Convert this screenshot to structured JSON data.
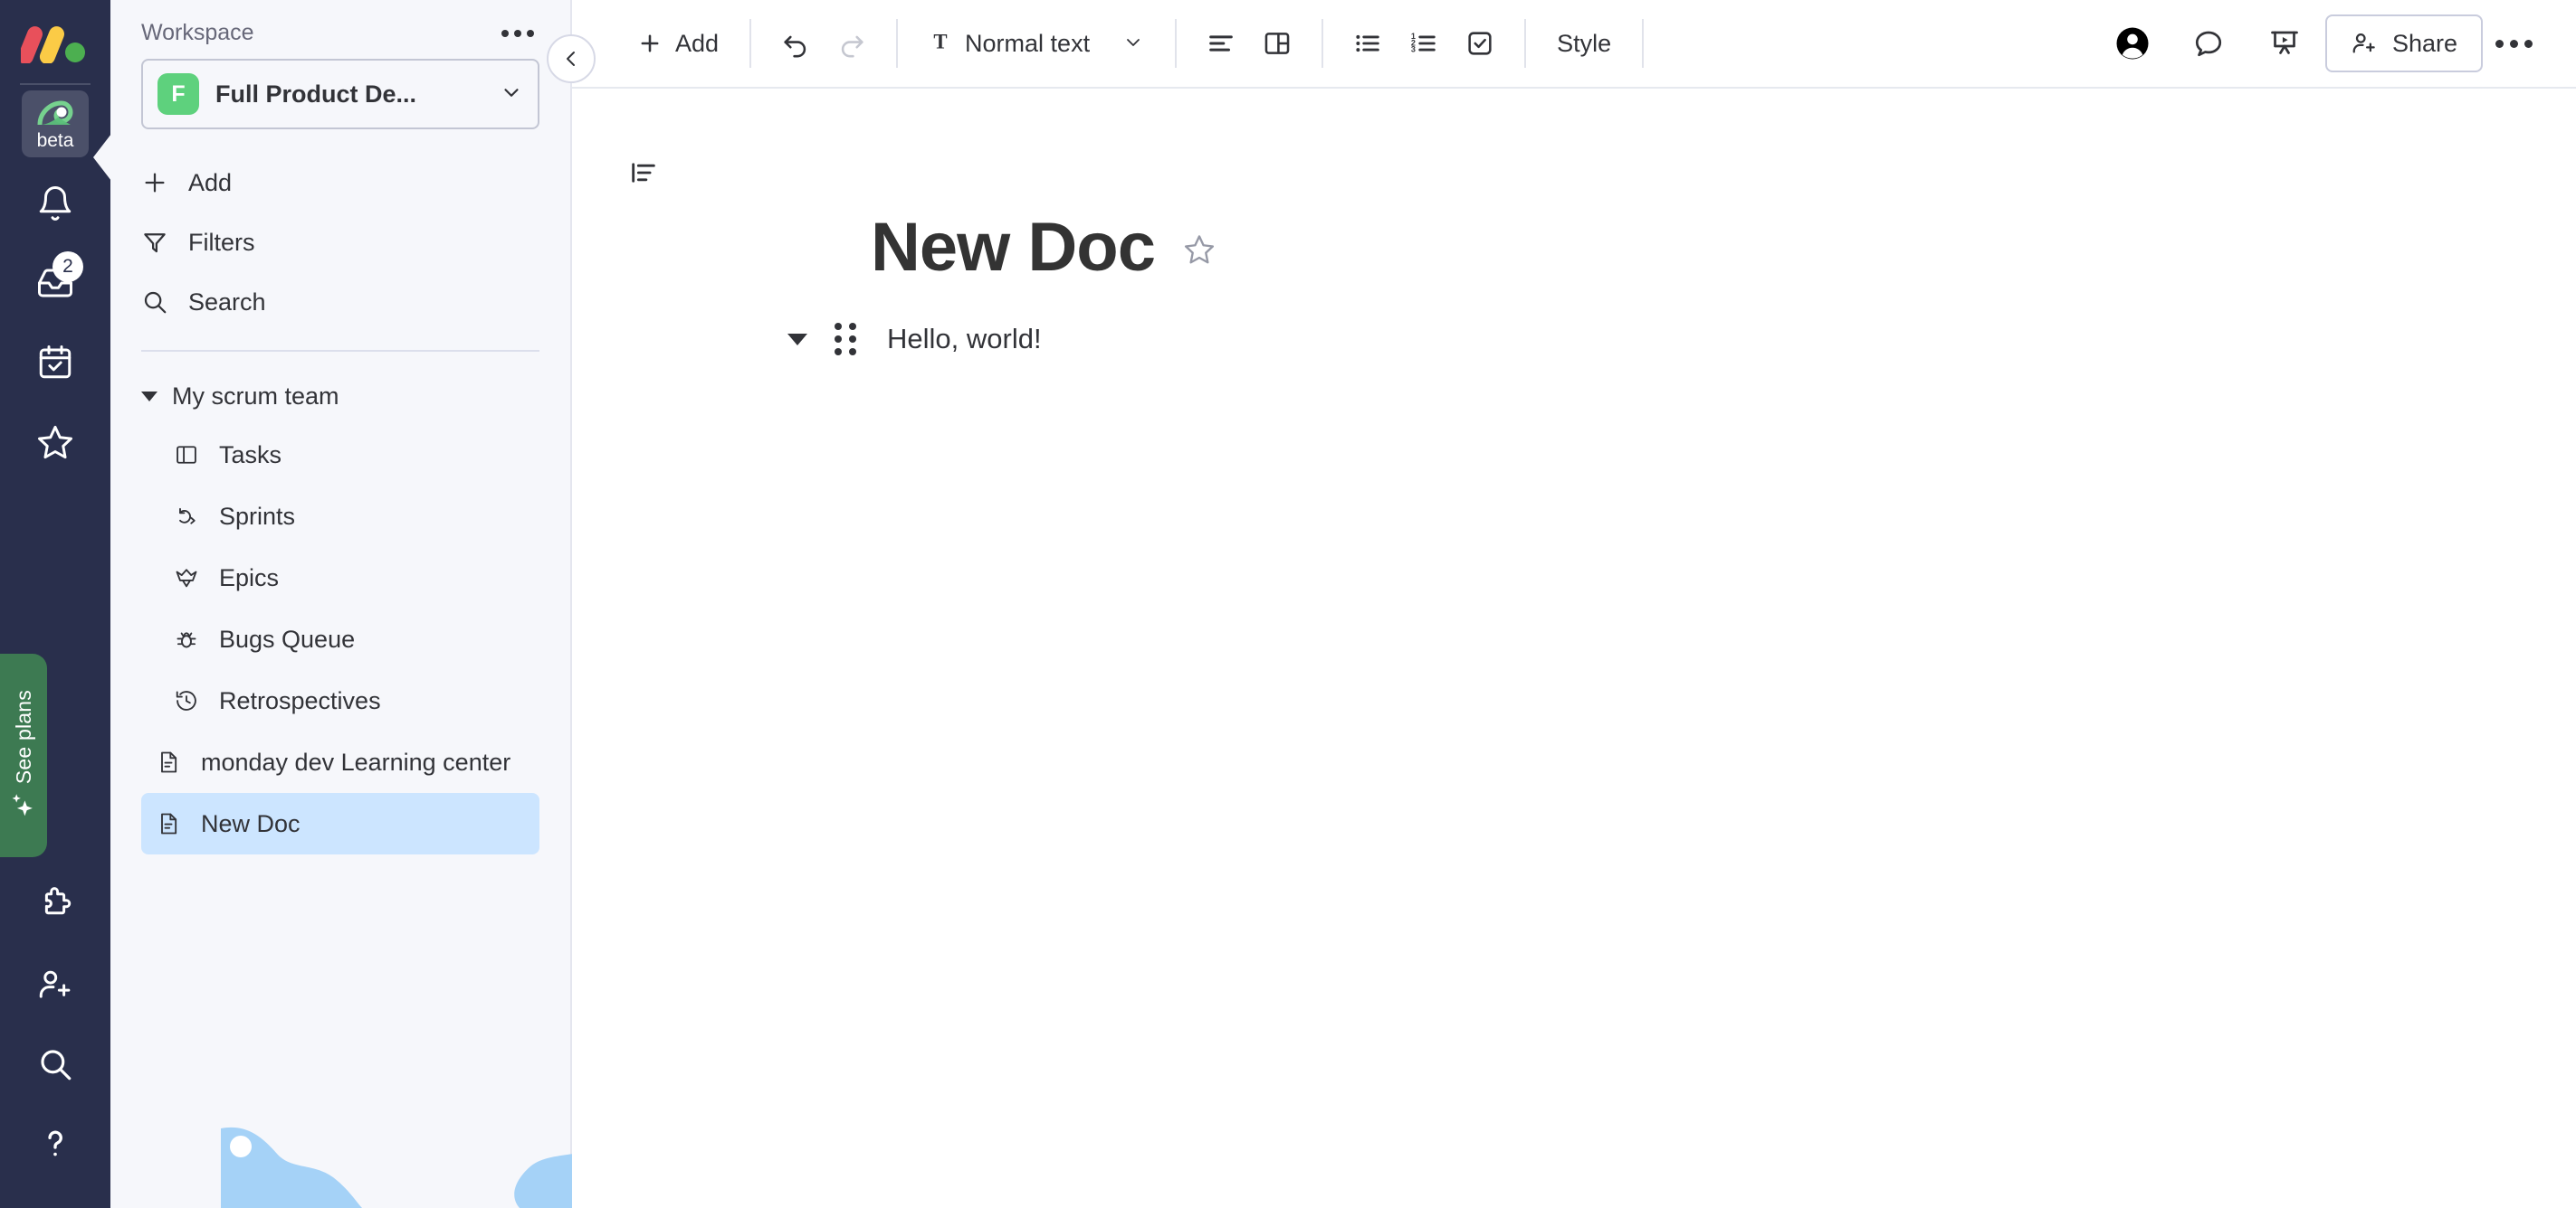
{
  "colors": {
    "rail_bg": "#292f4c",
    "sidebar_bg": "#f6f7fb",
    "accent_green": "#5ed17d",
    "plans_green": "#3d7a52",
    "selected_blue": "#cce5ff",
    "illustration_blue": "#a5d2f7",
    "logo_red": "#e8505b",
    "logo_yellow": "#fbcb46",
    "logo_green": "#4caf50"
  },
  "rail": {
    "logo_name": "monday-logo",
    "items": [
      {
        "name": "beta-workspace",
        "icon": "monday-dev-icon",
        "label": "beta",
        "badge": "",
        "active": true
      },
      {
        "name": "notifications",
        "icon": "bell-icon",
        "label": "",
        "badge": "",
        "active": false
      },
      {
        "name": "inbox",
        "icon": "inbox-icon",
        "label": "",
        "badge": "2",
        "active": false
      },
      {
        "name": "my-work",
        "icon": "calendar-check-icon",
        "label": "",
        "badge": "",
        "active": false
      },
      {
        "name": "favorites",
        "icon": "star-icon",
        "label": "",
        "badge": "",
        "active": false
      }
    ],
    "see_plans_label": "See plans",
    "bottom_items": [
      {
        "name": "apps",
        "icon": "puzzle-icon"
      },
      {
        "name": "invite-members",
        "icon": "person-plus-icon"
      },
      {
        "name": "search-everything",
        "icon": "search-icon"
      },
      {
        "name": "help",
        "icon": "question-mark-icon"
      }
    ]
  },
  "sidebar": {
    "header_title": "Workspace",
    "more_menu": "workspace-more-menu",
    "workspace": {
      "initial": "F",
      "name": "Full Product De...",
      "chevron": "chevron-down-icon"
    },
    "actions": [
      {
        "name": "add",
        "icon": "plus-icon",
        "label": "Add"
      },
      {
        "name": "filters",
        "icon": "funnel-icon",
        "label": "Filters"
      },
      {
        "name": "search",
        "icon": "search-icon",
        "label": "Search"
      }
    ],
    "group": {
      "name": "my-scrum-team",
      "label": "My scrum team",
      "expanded": true,
      "children": [
        {
          "name": "tasks",
          "icon": "board-icon",
          "label": "Tasks",
          "selected": false
        },
        {
          "name": "sprints",
          "icon": "sprint-icon",
          "label": "Sprints",
          "selected": false
        },
        {
          "name": "epics",
          "icon": "crown-icon",
          "label": "Epics",
          "selected": false
        },
        {
          "name": "bugs-queue",
          "icon": "bug-icon",
          "label": "Bugs Queue",
          "selected": false
        },
        {
          "name": "retrospectives",
          "icon": "history-icon",
          "label": "Retrospectives",
          "selected": false
        }
      ]
    },
    "root_items": [
      {
        "name": "monday-dev-learning-center",
        "icon": "doc-icon",
        "label": "monday dev Learning center",
        "selected": false
      },
      {
        "name": "new-doc",
        "icon": "doc-icon",
        "label": "New Doc",
        "selected": true
      }
    ]
  },
  "toolbar": {
    "collapse_sidebar": "chevron-left-icon",
    "add_label": "Add",
    "add_icon": "plus-icon",
    "undo_icon": "undo-icon",
    "redo_icon": "redo-icon",
    "redo_disabled": true,
    "text_style": {
      "icon": "text-T-icon",
      "label": "Normal text",
      "chevron": "chevron-down-icon"
    },
    "align_icon": "align-left-icon",
    "columns_icon": "layout-columns-icon",
    "bullet_list_icon": "bulleted-list-icon",
    "numbered_list_icon": "numbered-list-icon",
    "checklist_icon": "checklist-icon",
    "style_label": "Style",
    "avatar_icon": "user-avatar-icon",
    "comment_icon": "comment-bubble-icon",
    "present_icon": "presentation-icon",
    "share_label": "Share",
    "share_icon": "person-plus-icon",
    "more_icon": "more-options-icon"
  },
  "document": {
    "outline_icon": "document-outline-icon",
    "title": "New Doc",
    "favorite_icon": "star-outline-icon",
    "blocks": [
      {
        "name": "paragraph-block",
        "caret": "collapse-caret-icon",
        "drag_handle": "drag-handle-icon",
        "text": "Hello, world!"
      }
    ]
  }
}
